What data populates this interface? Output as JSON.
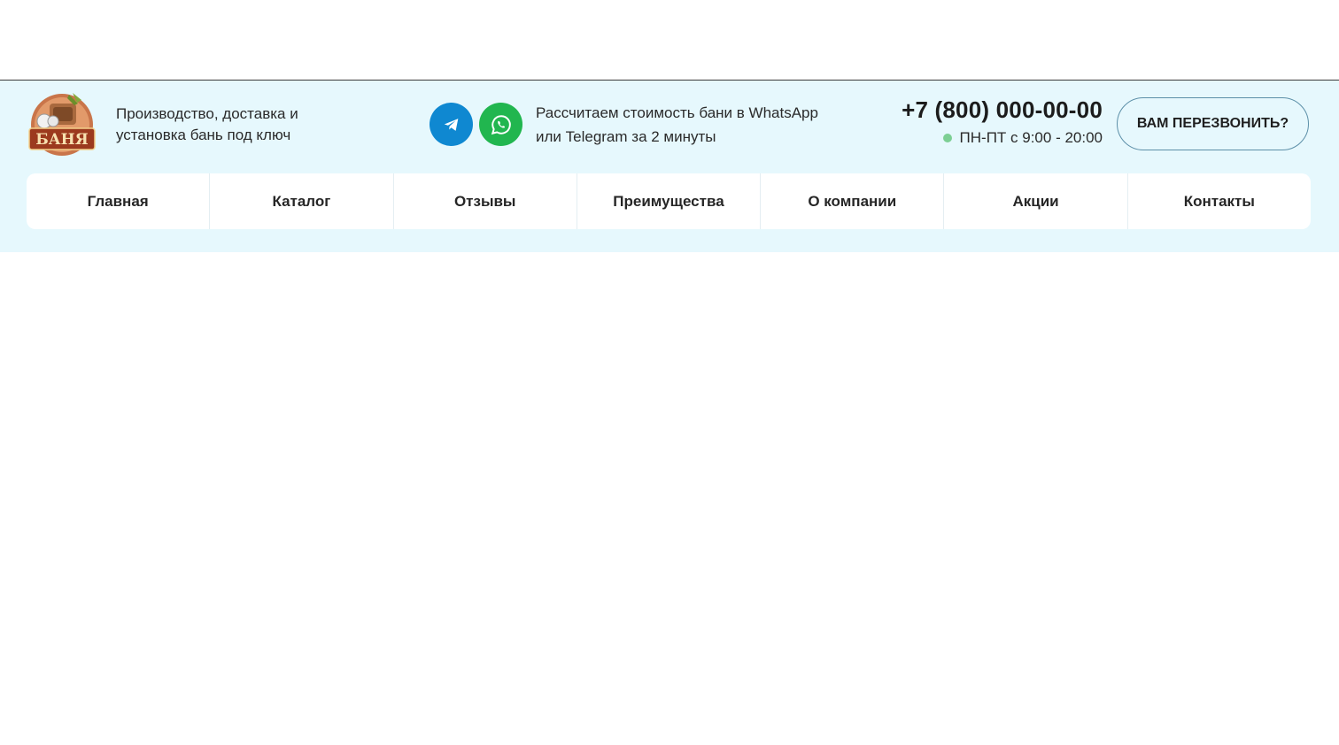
{
  "header": {
    "tagline": "Производство, доставка и установка бань под ключ",
    "calc_text": "Рассчитаем стоимость бани в WhatsApp или Telegram за 2 минуты",
    "phone": "+7 (800) 000-00-00",
    "hours": "ПН-ПТ с 9:00 - 20:00",
    "callback_label": "ВАМ ПЕРЕЗВОНИТЬ?",
    "logo_text": "БАНЯ",
    "colors": {
      "header_bg": "#e6f8fd",
      "telegram": "#0f88d1",
      "whatsapp": "#21b64f",
      "status_dot": "#7ccf94"
    },
    "icons": {
      "telegram": "telegram-icon",
      "whatsapp": "whatsapp-icon"
    }
  },
  "nav": {
    "items": [
      {
        "label": "Главная"
      },
      {
        "label": "Каталог"
      },
      {
        "label": "Отзывы"
      },
      {
        "label": "Преимущества"
      },
      {
        "label": "О компании"
      },
      {
        "label": "Акции"
      },
      {
        "label": "Контакты"
      }
    ]
  }
}
